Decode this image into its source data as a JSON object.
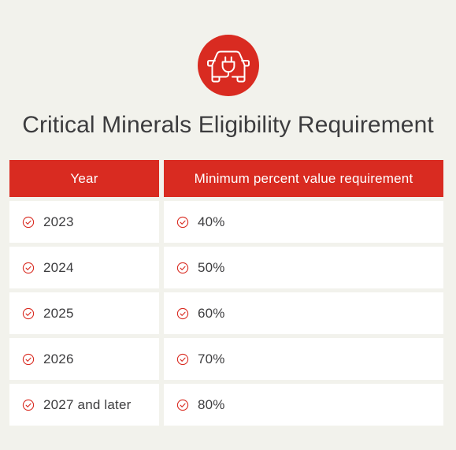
{
  "colors": {
    "background": "#f2f2ec",
    "accent_red": "#d92b21",
    "text_dark": "#3c3c3e",
    "cell_bg": "#ffffff",
    "header_text": "#ffffff"
  },
  "badge": {
    "icon_name": "electric-vehicle-icon",
    "background": "#d92b21"
  },
  "header": {
    "title": "Critical Minerals Eligibility Requirement"
  },
  "table": {
    "columns": [
      {
        "key": "year",
        "label": "Year"
      },
      {
        "key": "value",
        "label": "Minimum percent value requirement"
      }
    ],
    "row_icon_name": "check-circle-icon",
    "rows": [
      {
        "year": "2023",
        "value": "40%"
      },
      {
        "year": "2024",
        "value": "50%"
      },
      {
        "year": "2025",
        "value": "60%"
      },
      {
        "year": "2026",
        "value": "70%"
      },
      {
        "year": "2027 and later",
        "value": "80%"
      }
    ]
  }
}
